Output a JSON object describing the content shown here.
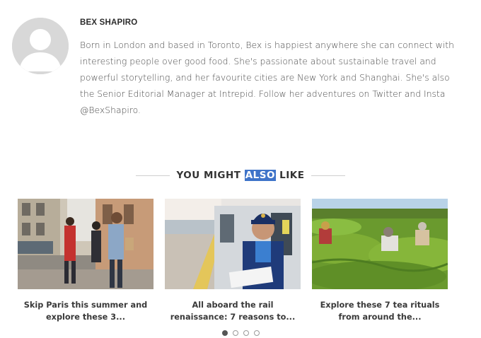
{
  "author": {
    "name": "BEX SHAPIRO",
    "bio": "Born in London and based in Toronto, Bex is happiest anywhere she can connect with interesting people over good food. She's passionate about sustainable travel and powerful storytelling, and her favourite cities are New York and Shanghai. She's also the Senior Editorial Manager at Intrepid. Follow her adventures on Twitter and Insta @BexShapiro."
  },
  "related": {
    "heading_pre": "YOU MIGHT ",
    "heading_highlight": "ALSO",
    "heading_post": " LIKE",
    "cards": [
      {
        "caption": "Skip Paris this summer and explore these 3..."
      },
      {
        "caption": "All aboard the rail renaissance: 7 reasons to..."
      },
      {
        "caption": "Explore these 7 tea rituals from around the..."
      }
    ]
  },
  "carousel": {
    "total_pages": 4,
    "current_page": 1
  }
}
